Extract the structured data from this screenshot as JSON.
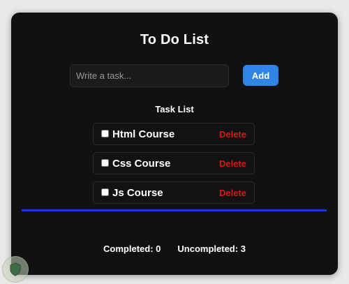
{
  "app": {
    "title": "To Do List"
  },
  "input": {
    "placeholder": "Write a task...",
    "value": ""
  },
  "buttons": {
    "add_label": "Add",
    "delete_label": "Delete"
  },
  "list": {
    "title": "Task List",
    "items": [
      {
        "label": "Html Course",
        "checked": false
      },
      {
        "label": "Css Course",
        "checked": false
      },
      {
        "label": "Js Course",
        "checked": false
      }
    ]
  },
  "stats": {
    "completed_label": "Completed:",
    "completed_value": "0",
    "uncompleted_label": "Uncompleted:",
    "uncompleted_value": "3"
  },
  "colors": {
    "card_bg": "#111111",
    "accent": "#2f84e6",
    "delete": "#d81818",
    "divider": "#1a36d6"
  },
  "icons": {
    "corner_logo": "shield-logo-icon"
  }
}
